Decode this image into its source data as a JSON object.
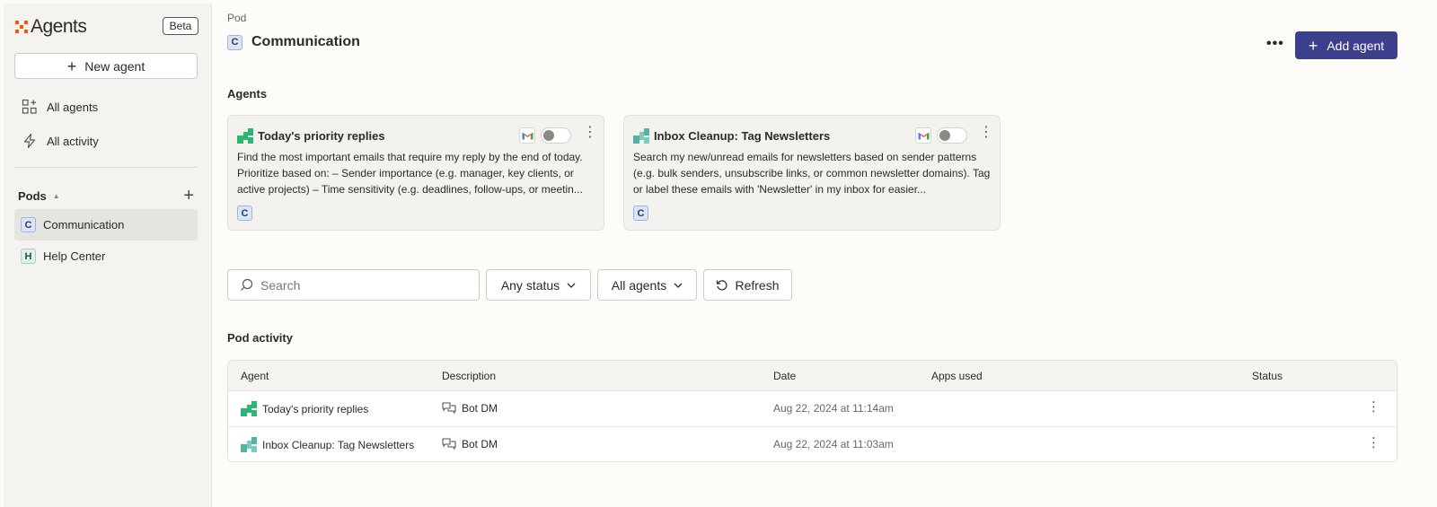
{
  "sidebar": {
    "brand": "Agents",
    "beta_label": "Beta",
    "new_agent_label": "New agent",
    "nav": [
      {
        "label": "All agents",
        "icon": "grid-plus-icon"
      },
      {
        "label": "All activity",
        "icon": "lightning-icon"
      }
    ],
    "pods_label": "Pods",
    "pods": [
      {
        "badge": "C",
        "label": "Communication",
        "active": true
      },
      {
        "badge": "H",
        "label": "Help Center",
        "active": false
      }
    ]
  },
  "header": {
    "breadcrumb": "Pod",
    "badge": "C",
    "title": "Communication",
    "add_agent_label": "Add agent"
  },
  "agents_section": {
    "title": "Agents",
    "cards": [
      {
        "title": "Today's priority replies",
        "description": "Find the most important emails that require my reply by the end of today. Prioritize based on: – Sender importance (e.g. manager, key clients, or active projects) – Time sensitivity (e.g. deadlines, follow-ups, or meetin...",
        "pod_badge": "C",
        "app": "gmail-icon",
        "enabled": false
      },
      {
        "title": "Inbox Cleanup: Tag Newsletters",
        "description": "Search my new/unread emails for newsletters based on sender patterns (e.g. bulk senders, unsubscribe links, or common newsletter domains). Tag or label these emails with 'Newsletter' in my inbox for easier...",
        "pod_badge": "C",
        "app": "gmail-icon",
        "enabled": false
      }
    ]
  },
  "filters": {
    "search_placeholder": "Search",
    "status_label": "Any status",
    "agents_label": "All agents",
    "refresh_label": "Refresh"
  },
  "activity": {
    "title": "Pod activity",
    "columns": [
      "Agent",
      "Description",
      "Date",
      "Apps used",
      "Status"
    ],
    "rows": [
      {
        "agent": "Today's priority replies",
        "description": "Bot DM",
        "date": "Aug 22, 2024 at 11:14am"
      },
      {
        "agent": "Inbox Cleanup: Tag Newsletters",
        "description": "Bot DM",
        "date": "Aug 22, 2024 at 11:03am"
      }
    ]
  },
  "colors": {
    "brand_orange": "#ff4f00",
    "primary_button": "#3b3f8c",
    "agent_green": "#2bb673",
    "agent_teal": "#4fb3a6"
  }
}
